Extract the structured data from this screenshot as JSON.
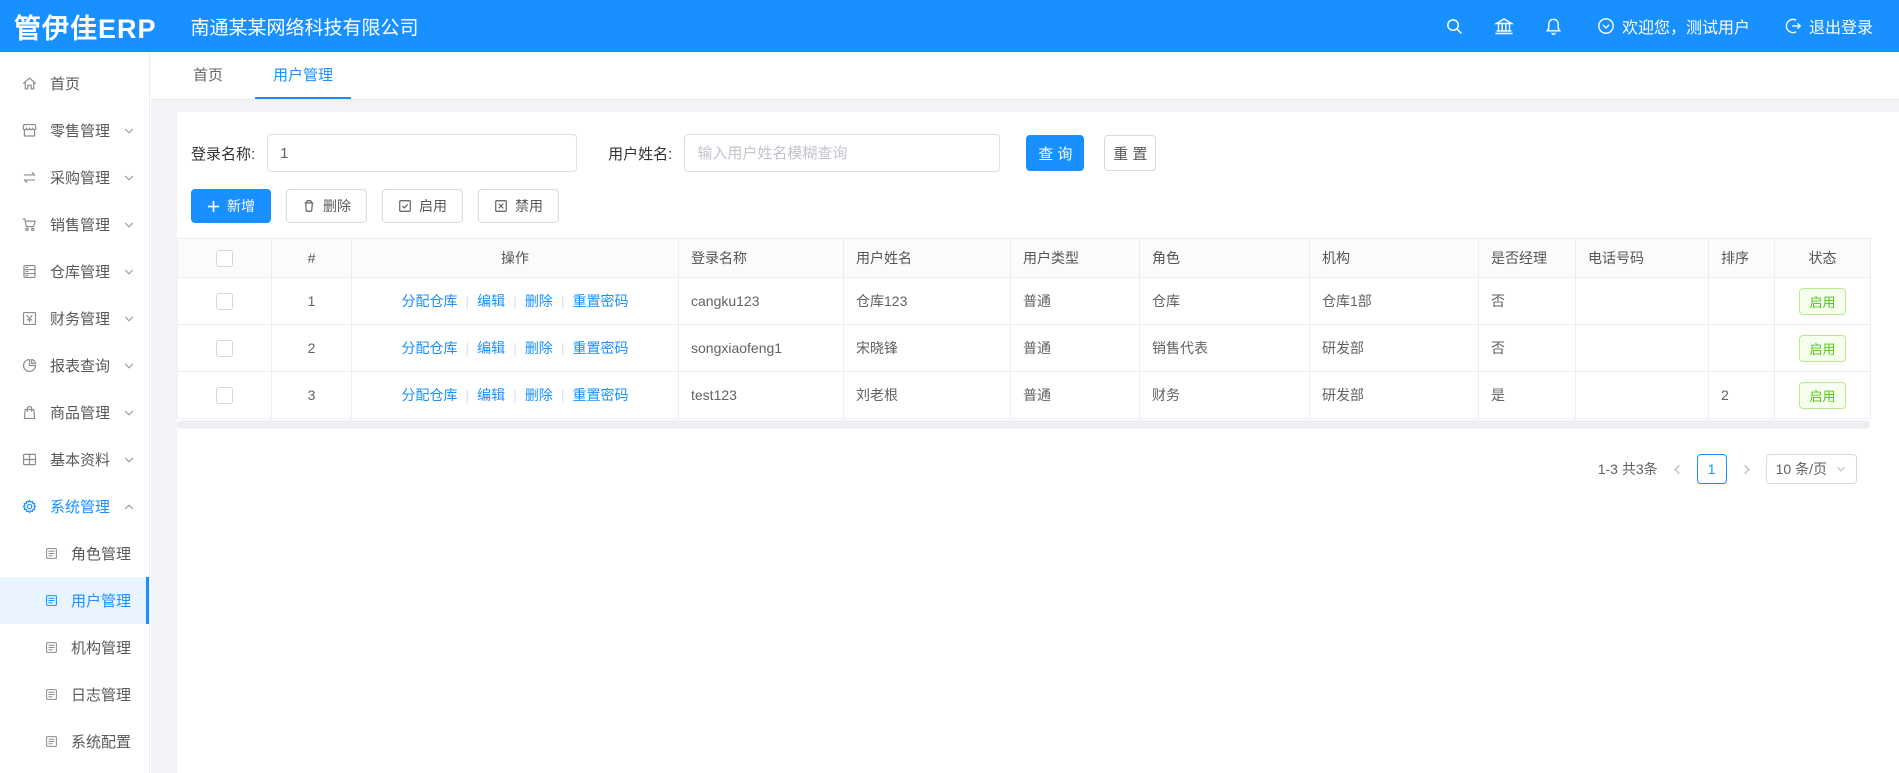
{
  "header": {
    "logo": "管伊佳ERP",
    "company": "南通某某网络科技有限公司",
    "welcome": "欢迎您，测试用户",
    "logout": "退出登录"
  },
  "sidebar": {
    "items": [
      {
        "id": "home",
        "label": "首页",
        "icon": "home-icon",
        "chevron": null,
        "sub": false,
        "state": "normal"
      },
      {
        "id": "retail",
        "label": "零售管理",
        "icon": "shop-icon",
        "chevron": "down",
        "sub": false,
        "state": "normal"
      },
      {
        "id": "purchase",
        "label": "采购管理",
        "icon": "sync-icon",
        "chevron": "down",
        "sub": false,
        "state": "normal"
      },
      {
        "id": "sales",
        "label": "销售管理",
        "icon": "cart-icon",
        "chevron": "down",
        "sub": false,
        "state": "normal"
      },
      {
        "id": "warehouse",
        "label": "仓库管理",
        "icon": "warehouse-icon",
        "chevron": "down",
        "sub": false,
        "state": "normal"
      },
      {
        "id": "finance",
        "label": "财务管理",
        "icon": "finance-icon",
        "chevron": "down",
        "sub": false,
        "state": "normal"
      },
      {
        "id": "report",
        "label": "报表查询",
        "icon": "report-icon",
        "chevron": "down",
        "sub": false,
        "state": "normal"
      },
      {
        "id": "goods",
        "label": "商品管理",
        "icon": "goods-icon",
        "chevron": "down",
        "sub": false,
        "state": "normal"
      },
      {
        "id": "basic",
        "label": "基本资料",
        "icon": "grid-icon",
        "chevron": "down",
        "sub": false,
        "state": "normal"
      },
      {
        "id": "system",
        "label": "系统管理",
        "icon": "gear-icon",
        "chevron": "up",
        "sub": false,
        "state": "parent-active"
      },
      {
        "id": "role",
        "label": "角色管理",
        "icon": "doc-icon",
        "chevron": null,
        "sub": true,
        "state": "normal"
      },
      {
        "id": "user",
        "label": "用户管理",
        "icon": "doc-icon",
        "chevron": null,
        "sub": true,
        "state": "selected"
      },
      {
        "id": "org",
        "label": "机构管理",
        "icon": "doc-icon",
        "chevron": null,
        "sub": true,
        "state": "normal"
      },
      {
        "id": "log",
        "label": "日志管理",
        "icon": "doc-icon",
        "chevron": null,
        "sub": true,
        "state": "normal"
      },
      {
        "id": "config",
        "label": "系统配置",
        "icon": "doc-icon",
        "chevron": null,
        "sub": true,
        "state": "normal"
      }
    ]
  },
  "tabs": [
    {
      "label": "首页",
      "active": false
    },
    {
      "label": "用户管理",
      "active": true
    }
  ],
  "filter": {
    "login_name_label": "登录名称:",
    "login_name_value": "1",
    "user_name_label": "用户姓名:",
    "user_name_placeholder": "输入用户姓名模糊查询",
    "search_button": "查 询",
    "reset_button": "重 置"
  },
  "toolbar": {
    "add": "新增",
    "delete": "删除",
    "enable": "启用",
    "disable": "禁用"
  },
  "table": {
    "columns": [
      "#",
      "操作",
      "登录名称",
      "用户姓名",
      "用户类型",
      "角色",
      "机构",
      "是否经理",
      "电话号码",
      "排序",
      "状态"
    ],
    "action_links": [
      "分配仓库",
      "编辑",
      "删除",
      "重置密码"
    ],
    "rows": [
      {
        "index": "1",
        "login": "cangku123",
        "name": "仓库123",
        "type": "普通",
        "role": "仓库",
        "org": "仓库1部",
        "manager": "否",
        "phone": "",
        "sort": "",
        "status": "启用"
      },
      {
        "index": "2",
        "login": "songxiaofeng1",
        "name": "宋晓锋",
        "type": "普通",
        "role": "销售代表",
        "org": "研发部",
        "manager": "否",
        "phone": "",
        "sort": "",
        "status": "启用"
      },
      {
        "index": "3",
        "login": "test123",
        "name": "刘老根",
        "type": "普通",
        "role": "财务",
        "org": "研发部",
        "manager": "是",
        "phone": "",
        "sort": "2",
        "status": "启用"
      }
    ]
  },
  "pagination": {
    "total": "1-3 共3条",
    "current_page": "1",
    "page_size": "10 条/页"
  },
  "colors": {
    "primary": "#1890ff",
    "success": "#52c41a",
    "success_border": "#b7eb8f",
    "success_bg": "#f6ffed"
  }
}
